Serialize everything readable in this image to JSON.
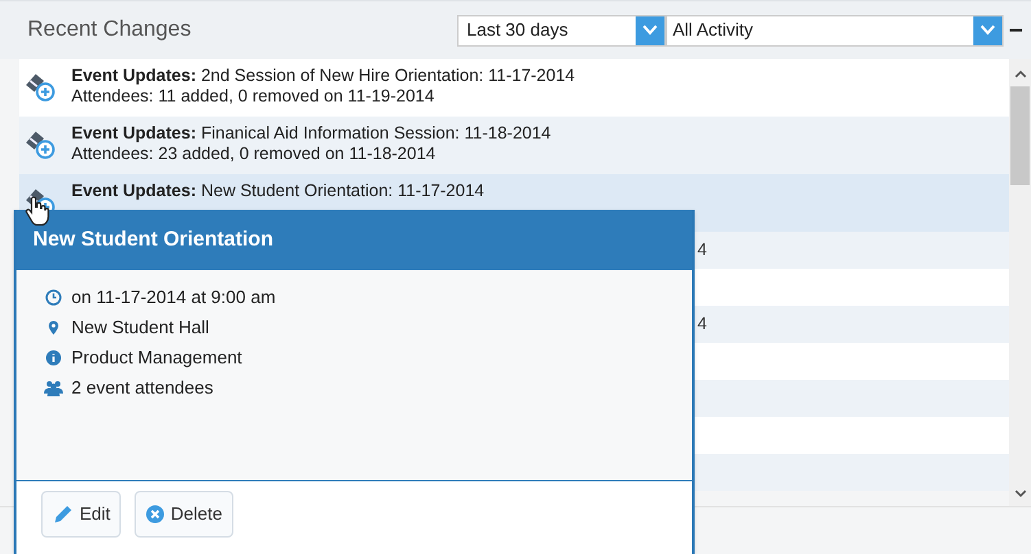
{
  "panel": {
    "title": "Recent Changes",
    "period_select": {
      "value": "Last 30 days"
    },
    "activity_select": {
      "value": "All Activity"
    },
    "collapse": "−"
  },
  "changes": [
    {
      "label": "Event Updates:",
      "title": "2nd Session of New Hire Orientation: 11-17-2014",
      "detail": "Attendees: 11 added, 0 removed on 11-19-2014",
      "selected": false
    },
    {
      "label": "Event Updates:",
      "title": "Finanical Aid Information Session: 11-18-2014",
      "detail": "Attendees: 23 added, 0 removed on 11-18-2014",
      "selected": false
    },
    {
      "label": "Event Updates:",
      "title": "New Student Orientation: 11-17-2014",
      "selected": true
    }
  ],
  "hidden_rows": [
    {
      "fragment": "4"
    },
    {},
    {
      "fragment": "4"
    },
    {},
    {},
    {},
    {}
  ],
  "popup": {
    "title": "New Student Orientation",
    "details": [
      {
        "kind": "time",
        "text": "on 11-17-2014 at 9:00 am"
      },
      {
        "kind": "location",
        "text": "New Student Hall"
      },
      {
        "kind": "info",
        "text": "Product Management"
      },
      {
        "kind": "people",
        "text": "2 event attendees"
      }
    ],
    "buttons": [
      {
        "kind": "edit",
        "label": "Edit"
      },
      {
        "kind": "delete",
        "label": "Delete"
      }
    ]
  }
}
